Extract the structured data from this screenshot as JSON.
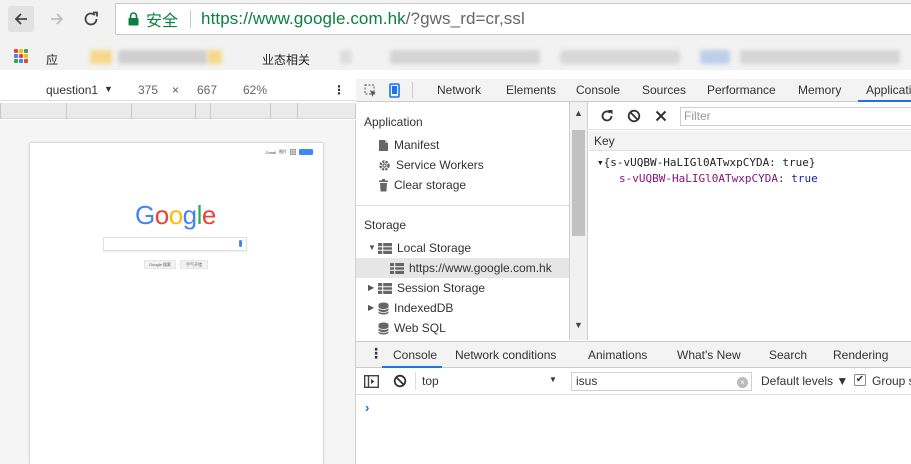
{
  "browser": {
    "secure_label": "安全",
    "url_scheme": "https://",
    "url_host": "www.google.com.hk",
    "url_path": "/?gws_rd=cr,ssl",
    "bookmarks": [
      {
        "label": "应"
      },
      {
        "label": "业态相关"
      }
    ]
  },
  "device_toolbar": {
    "device": "question1",
    "dropdown_arrow": "▼",
    "width": "375",
    "times": "×",
    "height": "667",
    "zoom": "62%",
    "more": "⋮"
  },
  "emulated_page": {
    "top_links": [
      "Gmail",
      "图片"
    ],
    "logo": [
      "G",
      "o",
      "o",
      "g",
      "l",
      "e"
    ],
    "logo_colors": [
      "#4285f4",
      "#ea4335",
      "#fbbc05",
      "#4285f4",
      "#34a853",
      "#ea4335"
    ],
    "search_button": "Google 搜索",
    "lucky_button": "手气不错"
  },
  "devtools": {
    "tabs": [
      "Network",
      "Elements",
      "Console",
      "Sources",
      "Performance",
      "Memory",
      "Applicati"
    ],
    "active_tab": "Applicati",
    "sidebar": {
      "application_heading": "Application",
      "manifest": "Manifest",
      "service_workers": "Service Workers",
      "clear_storage": "Clear storage",
      "storage_heading": "Storage",
      "local_storage": "Local Storage",
      "local_storage_origin": "https://www.google.com.hk",
      "session_storage": "Session Storage",
      "indexeddb": "IndexedDB",
      "web_sql": "Web SQL"
    },
    "storage": {
      "filter_placeholder": "Filter",
      "key_header": "Key",
      "object_line": "▾{s-vUQBW-HaLIGl0ATwxpCYDA: true}",
      "prop_key": "s-vUQBW-HaLIGl0ATwxpCYDA",
      "prop_sep": ": ",
      "prop_value": "true"
    },
    "drawer": {
      "tabs": [
        "Console",
        "Network conditions",
        "Animations",
        "What's New",
        "Search",
        "Rendering"
      ],
      "active_tab": "Console",
      "context": "top",
      "filter_value": "isus",
      "levels": "Default levels ▼",
      "group_check": "✔",
      "group_label": "Group s",
      "prompt": "›"
    }
  },
  "colors": {
    "accent": "#1a73e8",
    "secure_green": "#0b8043"
  }
}
